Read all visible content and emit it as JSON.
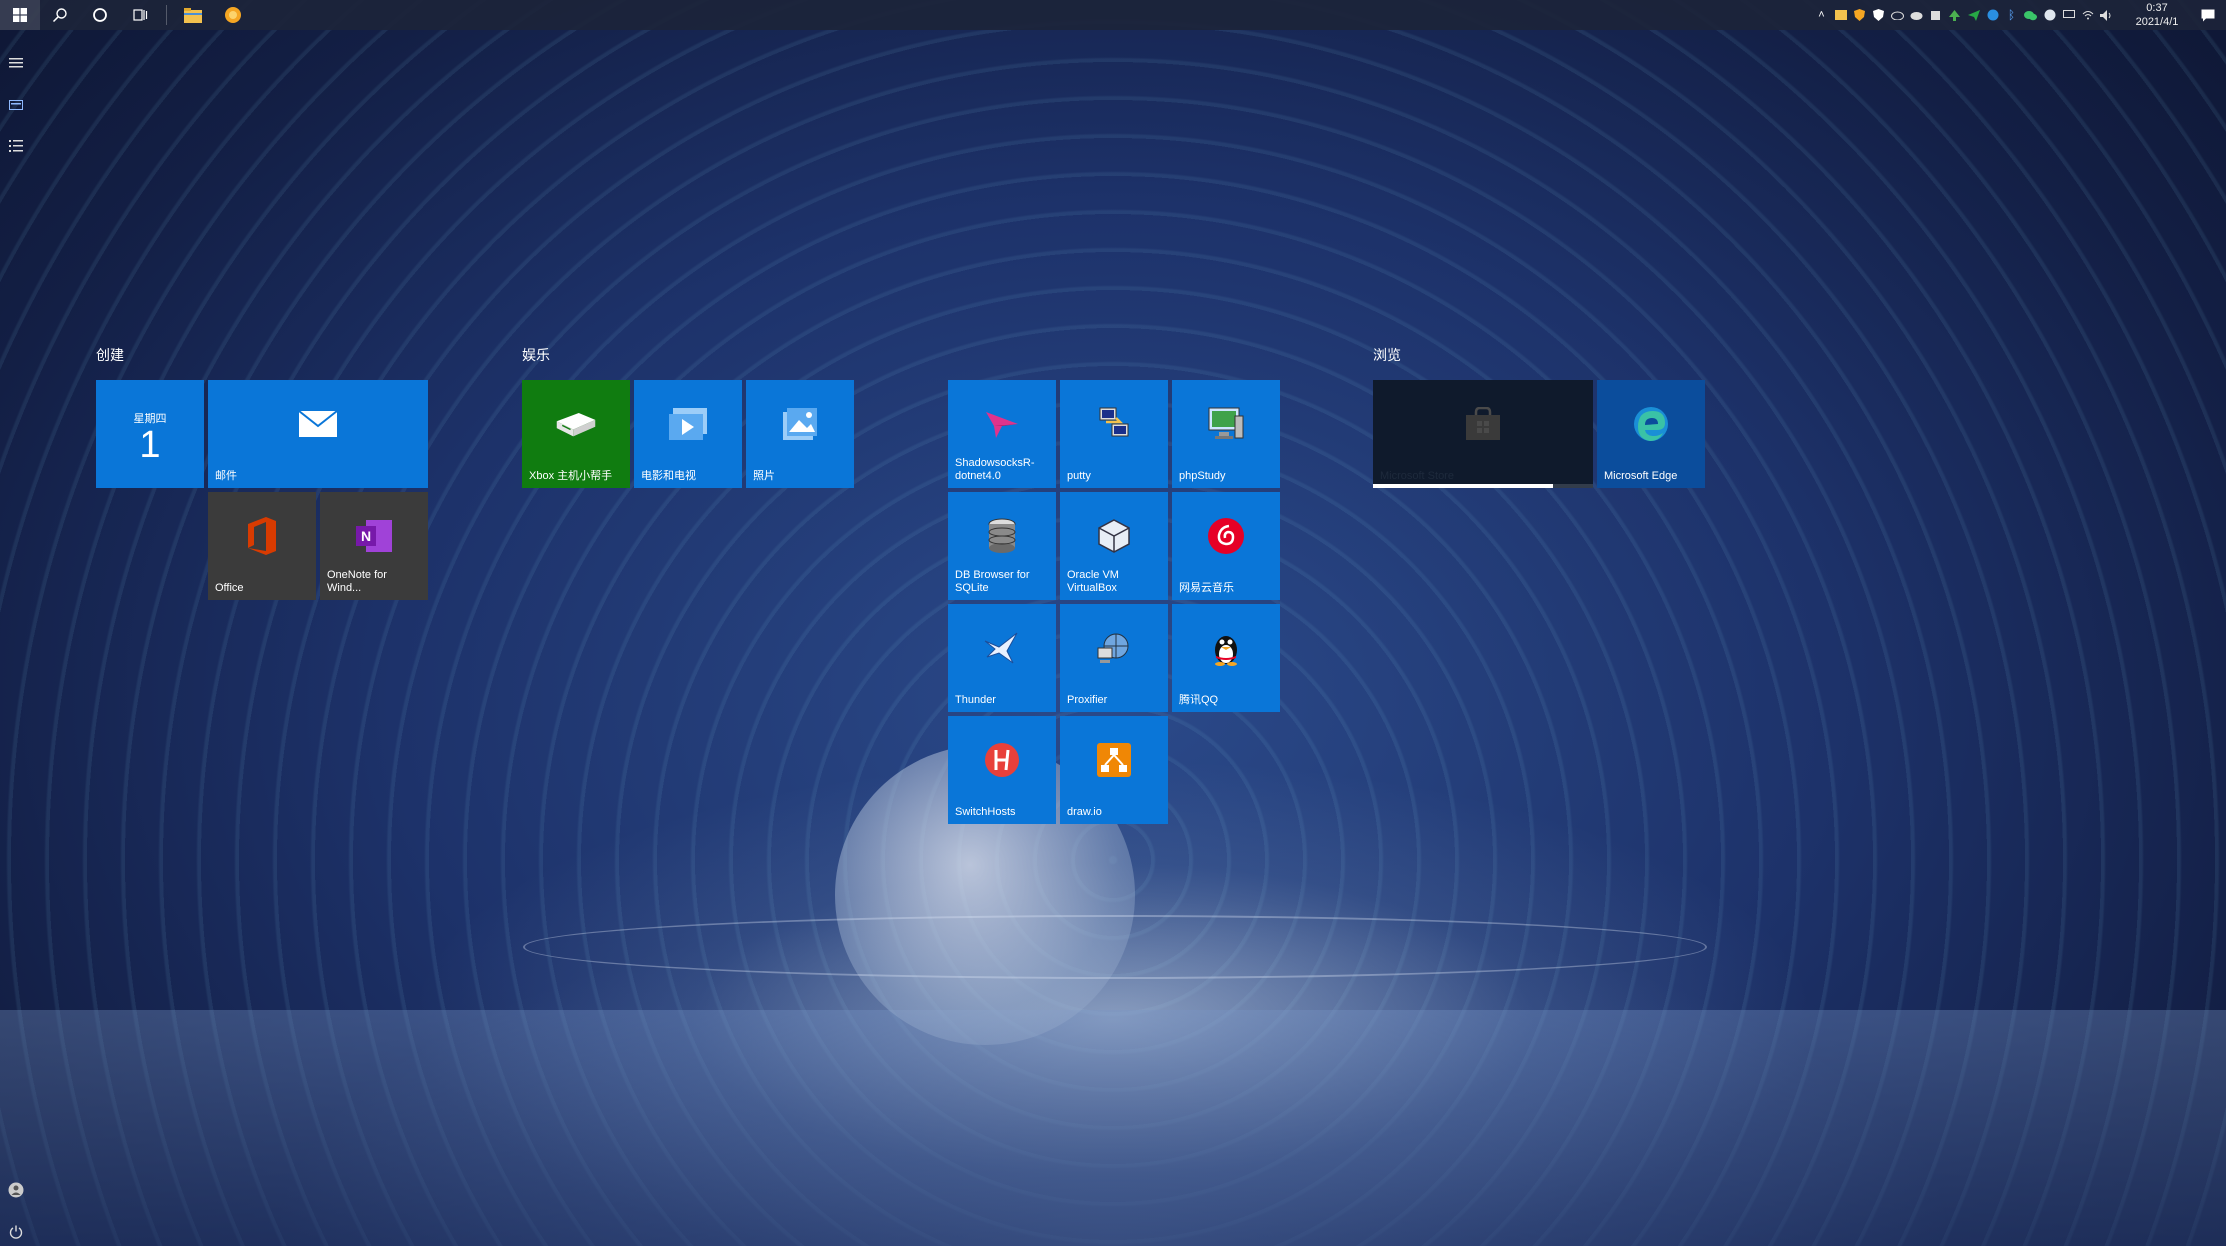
{
  "taskbar": {
    "pinned": [
      {
        "name": "file-explorer-icon",
        "glyph": "📁"
      },
      {
        "name": "browser-app-icon",
        "glyph": "●"
      }
    ],
    "tray_icons": [
      "^",
      "▲",
      "◆",
      "⛨",
      "☁",
      "☁",
      "▣",
      "▲",
      "◉",
      "✈",
      "ᛒ",
      "●",
      "◎",
      "⟡",
      "⟟",
      "🔊"
    ],
    "clock_time": "0:37",
    "clock_date": "2021/4/1"
  },
  "groups": {
    "create": {
      "title": "创建",
      "calendar": {
        "weekday": "星期四",
        "day": "1"
      },
      "mail_label": "邮件",
      "office_label": "Office",
      "onenote_label": "OneNote for Wind..."
    },
    "entertainment": {
      "title": "娱乐",
      "xbox_label": "Xbox 主机小帮手",
      "movies_label": "电影和电视",
      "photos_label": "照片"
    },
    "apps": {
      "tiles": [
        {
          "label": "ShadowsocksR-dotnet4.0"
        },
        {
          "label": "putty"
        },
        {
          "label": "phpStudy"
        },
        {
          "label": "DB Browser for SQLite"
        },
        {
          "label": "Oracle VM VirtualBox"
        },
        {
          "label": "网易云音乐"
        },
        {
          "label": "Thunder"
        },
        {
          "label": "Proxifier"
        },
        {
          "label": "腾讯QQ"
        },
        {
          "label": "SwitchHosts"
        },
        {
          "label": "draw.io"
        }
      ]
    },
    "browse": {
      "title": "浏览",
      "store_label": "Microsoft Store",
      "store_progress": 0.82,
      "edge_label": "Microsoft Edge"
    }
  },
  "colors": {
    "tile_blue": "#0a76d8",
    "xbox_green": "#107c10",
    "office_red": "#d83b01",
    "onenote_purple": "#7719aa",
    "drawio_orange": "#f08705"
  }
}
